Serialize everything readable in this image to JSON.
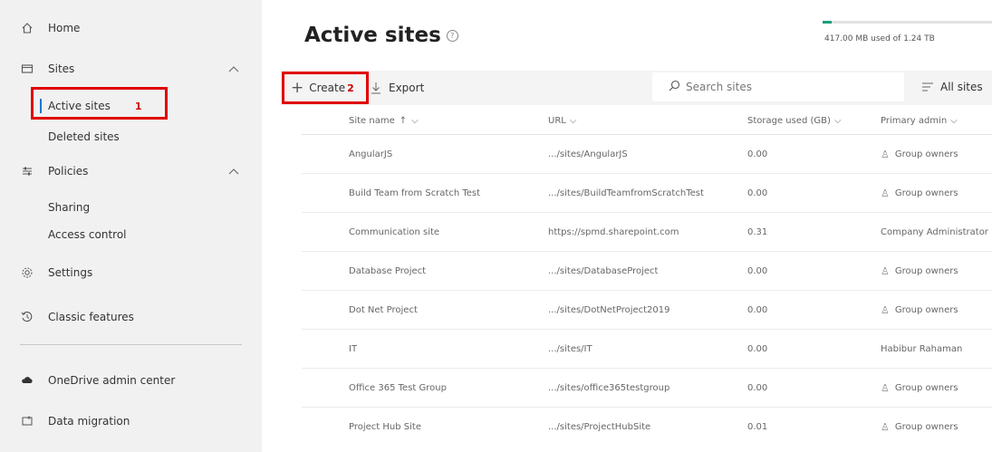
{
  "sidebar": {
    "home": "Home",
    "sites": "Sites",
    "active_sites": "Active sites",
    "active_marker": "1",
    "deleted_sites": "Deleted sites",
    "policies": "Policies",
    "sharing": "Sharing",
    "access_control": "Access control",
    "settings": "Settings",
    "classic_features": "Classic features",
    "onedrive": "OneDrive admin center",
    "data_migration": "Data migration"
  },
  "header": {
    "title": "Active sites",
    "storage_text": "417.00 MB used of 1.24 TB",
    "storage_fraction": 0.0003
  },
  "toolbar": {
    "create": "Create",
    "create_marker": "2",
    "export": "Export",
    "search_placeholder": "Search sites",
    "all_sites": "All sites"
  },
  "table": {
    "columns": {
      "site_name": "Site name",
      "url": "URL",
      "storage": "Storage used (GB)",
      "admin": "Primary admin"
    },
    "rows": [
      {
        "name": "AngularJS",
        "url": ".../sites/AngularJS",
        "storage": "0.00",
        "admin": "Group owners",
        "group": true
      },
      {
        "name": "Build Team from Scratch Test",
        "url": ".../sites/BuildTeamfromScratchTest",
        "storage": "0.00",
        "admin": "Group owners",
        "group": true
      },
      {
        "name": "Communication site",
        "url": "https://spmd.sharepoint.com",
        "storage": "0.31",
        "admin": "Company Administrator",
        "group": false
      },
      {
        "name": "Database Project",
        "url": ".../sites/DatabaseProject",
        "storage": "0.00",
        "admin": "Group owners",
        "group": true
      },
      {
        "name": "Dot Net Project",
        "url": ".../sites/DotNetProject2019",
        "storage": "0.00",
        "admin": "Group owners",
        "group": true
      },
      {
        "name": "IT",
        "url": ".../sites/IT",
        "storage": "0.00",
        "admin": "Habibur Rahaman",
        "group": false
      },
      {
        "name": "Office 365 Test Group",
        "url": ".../sites/office365testgroup",
        "storage": "0.00",
        "admin": "Group owners",
        "group": true
      },
      {
        "name": "Project Hub Site",
        "url": ".../sites/ProjectHubSite",
        "storage": "0.01",
        "admin": "Group owners",
        "group": true
      }
    ]
  },
  "colors": {
    "highlight": "#e00000",
    "accent": "#0078d4",
    "storage": "#1a9f7a"
  }
}
